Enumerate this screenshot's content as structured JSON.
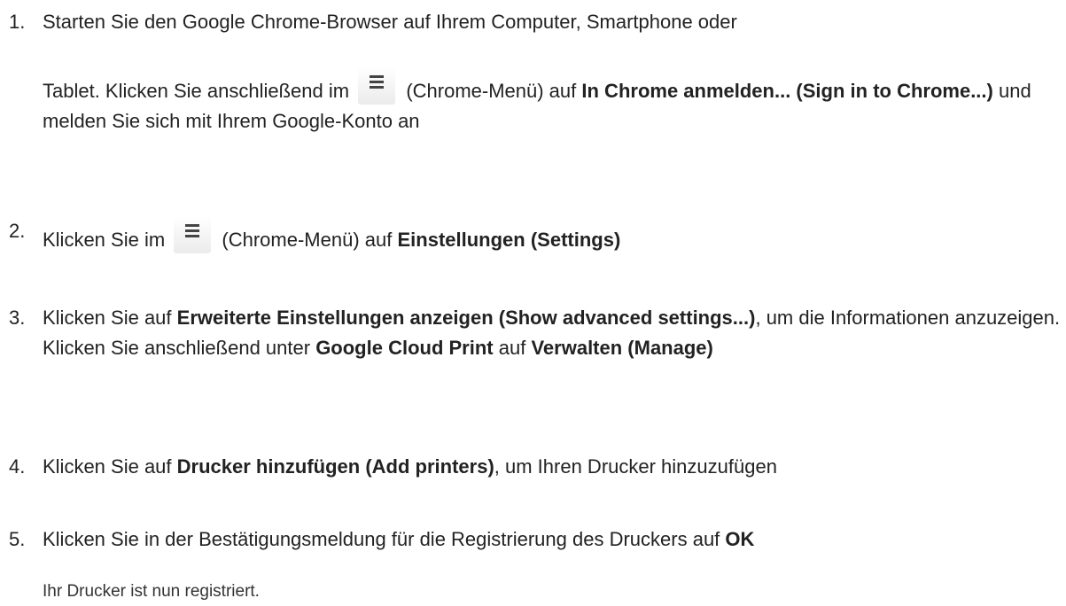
{
  "steps": [
    {
      "number": "1.",
      "line1": "Starten Sie den Google Chrome-Browser auf Ihrem Computer, Smartphone oder",
      "line2_a": "Tablet. Klicken Sie anschließend im",
      "icon": "chrome-menu-icon",
      "line2_b": "(Chrome-Menü) auf",
      "bold1": "In Chrome anmelden... (Sign in to Chrome...)",
      "line2_c": "und melden Sie sich mit Ihrem Google-Konto an"
    },
    {
      "number": "2.",
      "text_a": "Klicken Sie im",
      "icon": "chrome-menu-icon",
      "text_b": "(Chrome-Menü) auf",
      "bold1": "Einstellungen (Settings)"
    },
    {
      "number": "3.",
      "text_a": "Klicken Sie auf",
      "bold1": "Erweiterte Einstellungen anzeigen (Show advanced settings...)",
      "text_b": ", um die Informationen anzuzeigen. Klicken Sie anschließend unter",
      "bold2": "Google Cloud Print",
      "text_c": "auf",
      "bold3": "Verwalten (Manage)"
    },
    {
      "number": "4.",
      "text_a": "Klicken Sie auf",
      "bold1": "Drucker hinzufügen (Add printers)",
      "text_b": ", um Ihren Drucker hinzuzufügen"
    },
    {
      "number": "5.",
      "text_a": "Klicken Sie in der Bestätigungsmeldung für die Registrierung des Druckers auf",
      "bold1": "OK"
    }
  ],
  "note": "Ihr Drucker ist nun registriert."
}
